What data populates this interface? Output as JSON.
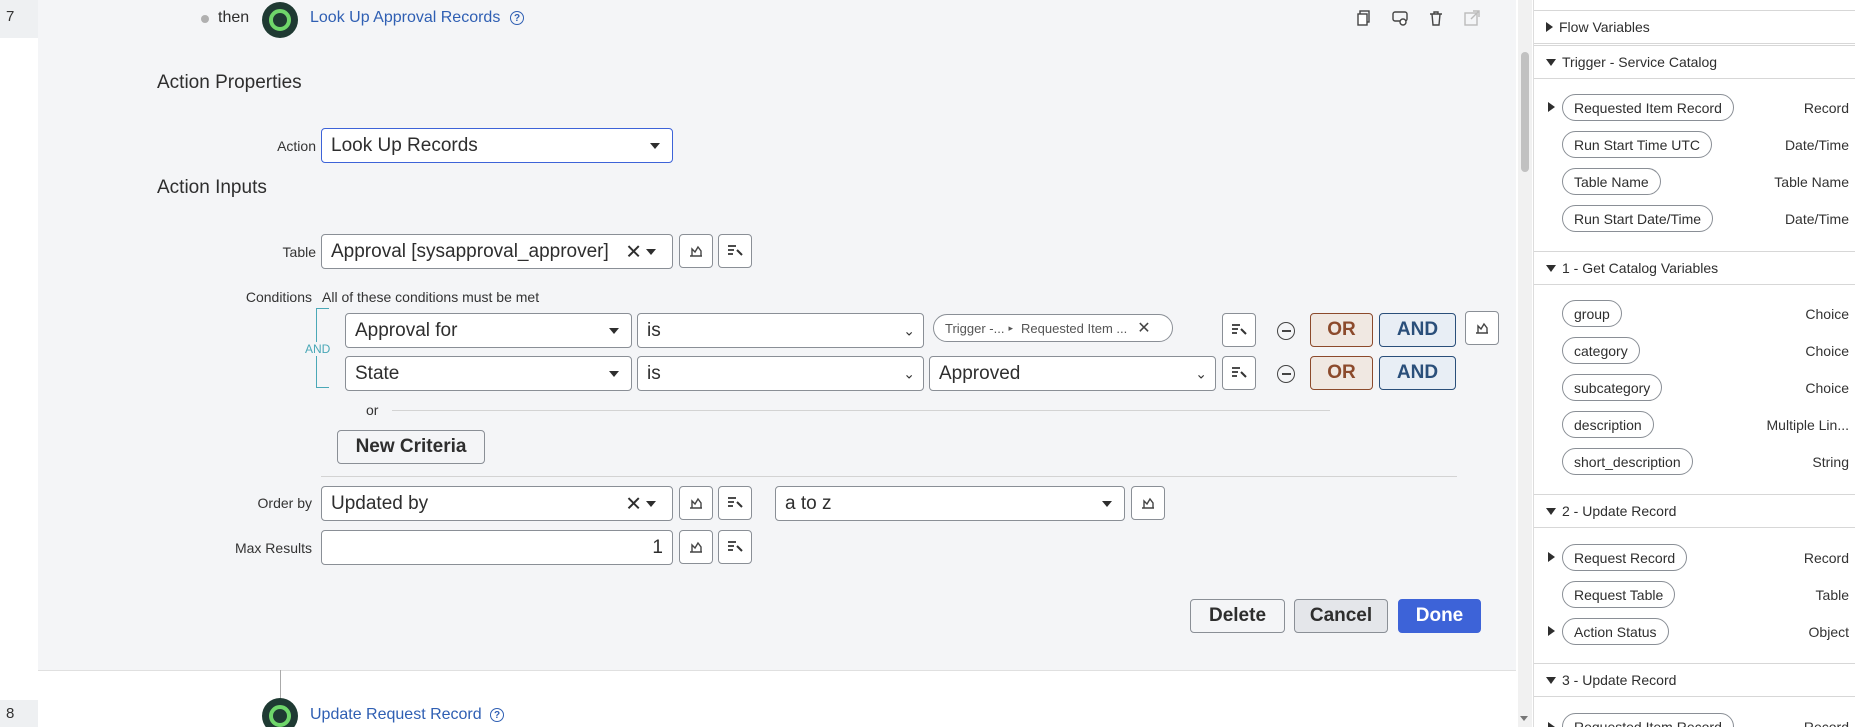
{
  "step7": {
    "number": "7",
    "then": "then",
    "title": "Look Up Approval Records",
    "help": "?"
  },
  "step8": {
    "number": "8",
    "title": "Update Request Record",
    "help": "?"
  },
  "action_properties": {
    "heading": "Action Properties",
    "action_label": "Action",
    "action_value": "Look Up Records"
  },
  "action_inputs": {
    "heading": "Action Inputs",
    "table_label": "Table",
    "table_value": "Approval [sysapproval_approver]",
    "conditions_label": "Conditions",
    "conditions_note": "All of these conditions must be met",
    "and_label": "AND",
    "rows": [
      {
        "field": "Approval for",
        "operator": "is",
        "value_pill_a": "Trigger -...",
        "value_pill_b": "Requested Item ...",
        "or": "OR",
        "and": "AND"
      },
      {
        "field": "State",
        "operator": "is",
        "value": "Approved",
        "or": "OR",
        "and": "AND"
      }
    ],
    "or_separator": "or",
    "new_criteria": "New Criteria",
    "order_by_label": "Order by",
    "order_by_value": "Updated by",
    "order_dir": "a to z",
    "max_results_label": "Max Results",
    "max_results_value": "1"
  },
  "footer_buttons": {
    "delete": "Delete",
    "cancel": "Cancel",
    "done": "Done"
  },
  "sidebar": {
    "sections": [
      {
        "title": "Flow Variables",
        "expanded": false,
        "items": []
      },
      {
        "title": "Trigger - Service Catalog",
        "expanded": true,
        "items": [
          {
            "label": "Requested Item Record",
            "type": "Record",
            "expandable": true
          },
          {
            "label": "Run Start Time UTC",
            "type": "Date/Time",
            "expandable": false
          },
          {
            "label": "Table Name",
            "type": "Table Name",
            "expandable": false
          },
          {
            "label": "Run Start Date/Time",
            "type": "Date/Time",
            "expandable": false
          }
        ]
      },
      {
        "title": "1 - Get Catalog Variables",
        "expanded": true,
        "items": [
          {
            "label": "group",
            "type": "Choice",
            "expandable": false
          },
          {
            "label": "category",
            "type": "Choice",
            "expandable": false
          },
          {
            "label": "subcategory",
            "type": "Choice",
            "expandable": false
          },
          {
            "label": "description",
            "type": "Multiple Lin...",
            "expandable": false
          },
          {
            "label": "short_description",
            "type": "String",
            "expandable": false
          }
        ]
      },
      {
        "title": "2 - Update Record",
        "expanded": true,
        "items": [
          {
            "label": "Request Record",
            "type": "Record",
            "expandable": true
          },
          {
            "label": "Request Table",
            "type": "Table",
            "expandable": false
          },
          {
            "label": "Action Status",
            "type": "Object",
            "expandable": true
          }
        ]
      },
      {
        "title": "3 - Update Record",
        "expanded": true,
        "items": [
          {
            "label": "Requested Item Record",
            "type": "Record",
            "expandable": true
          }
        ]
      }
    ]
  },
  "colors": {
    "primary": "#3d63d8",
    "or": "#8c4a2c",
    "and": "#2a4f7a",
    "link": "#2f5fb3",
    "panel_bg": "#f4f5f7"
  },
  "icons": [
    "copy-icon",
    "data-pill-picker-icon",
    "trash-icon",
    "open-external-icon",
    "script-icon",
    "step-circle-icon",
    "help-icon",
    "minus-circle-icon",
    "clear-icon",
    "caret-down-icon"
  ]
}
